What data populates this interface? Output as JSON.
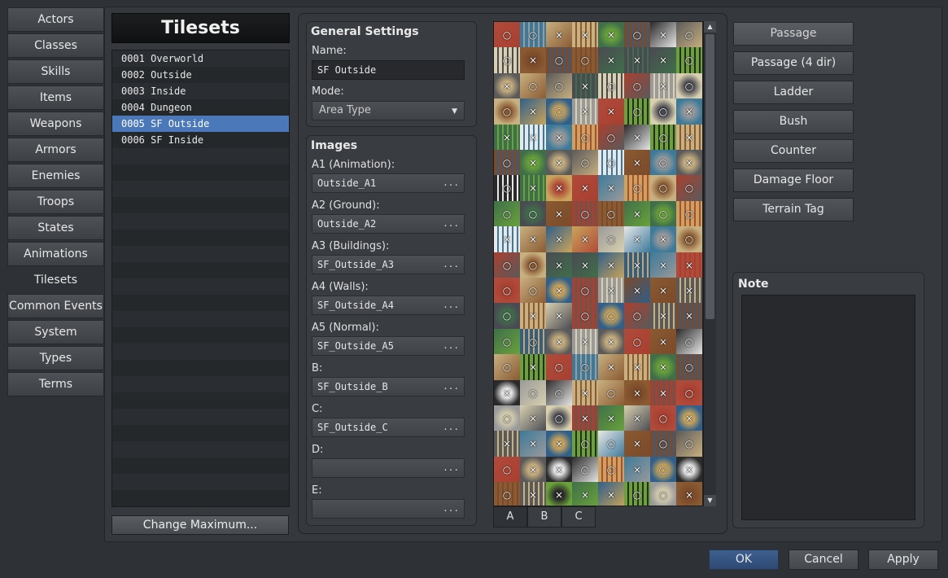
{
  "categories": [
    {
      "label": "Actors",
      "active": false
    },
    {
      "label": "Classes",
      "active": false
    },
    {
      "label": "Skills",
      "active": false
    },
    {
      "label": "Items",
      "active": false
    },
    {
      "label": "Weapons",
      "active": false
    },
    {
      "label": "Armors",
      "active": false
    },
    {
      "label": "Enemies",
      "active": false
    },
    {
      "label": "Troops",
      "active": false
    },
    {
      "label": "States",
      "active": false
    },
    {
      "label": "Animations",
      "active": false
    },
    {
      "label": "Tilesets",
      "active": true
    },
    {
      "label": "Common Events",
      "active": false
    },
    {
      "label": "System",
      "active": false
    },
    {
      "label": "Types",
      "active": false
    },
    {
      "label": "Terms",
      "active": false
    }
  ],
  "tileset_list": {
    "title": "Tilesets",
    "items": [
      {
        "label": "0001 Overworld",
        "selected": false
      },
      {
        "label": "0002 Outside",
        "selected": false
      },
      {
        "label": "0003 Inside",
        "selected": false
      },
      {
        "label": "0004 Dungeon",
        "selected": false
      },
      {
        "label": "0005 SF Outside",
        "selected": true
      },
      {
        "label": "0006 SF Inside",
        "selected": false
      }
    ],
    "change_max_label": "Change Maximum..."
  },
  "general": {
    "title": "General Settings",
    "name_label": "Name:",
    "name_value": "SF Outside",
    "mode_label": "Mode:",
    "mode_value": "Area Type"
  },
  "images": {
    "title": "Images",
    "ellipsis": "...",
    "slots": [
      {
        "label": "A1 (Animation):",
        "value": "Outside_A1"
      },
      {
        "label": "A2 (Ground):",
        "value": "Outside_A2"
      },
      {
        "label": "A3 (Buildings):",
        "value": "SF_Outside_A3"
      },
      {
        "label": "A4 (Walls):",
        "value": "SF_Outside_A4"
      },
      {
        "label": "A5 (Normal):",
        "value": "SF_Outside_A5"
      },
      {
        "label": "B:",
        "value": "SF_Outside_B"
      },
      {
        "label": "C:",
        "value": "SF_Outside_C"
      },
      {
        "label": "D:",
        "value": ""
      },
      {
        "label": "E:",
        "value": ""
      }
    ]
  },
  "tile_tabs": [
    {
      "label": "A",
      "active": true
    },
    {
      "label": "B",
      "active": false
    },
    {
      "label": "C",
      "active": false
    }
  ],
  "scroll": {
    "up": "▲",
    "down": "▼"
  },
  "flag_buttons": [
    {
      "label": "Passage"
    },
    {
      "label": "Passage (4 dir)"
    },
    {
      "label": "Ladder"
    },
    {
      "label": "Bush"
    },
    {
      "label": "Counter"
    },
    {
      "label": "Damage Floor"
    },
    {
      "label": "Terrain Tag"
    }
  ],
  "note": {
    "title": "Note",
    "value": ""
  },
  "footer": {
    "ok": "OK",
    "cancel": "Cancel",
    "apply": "Apply"
  }
}
